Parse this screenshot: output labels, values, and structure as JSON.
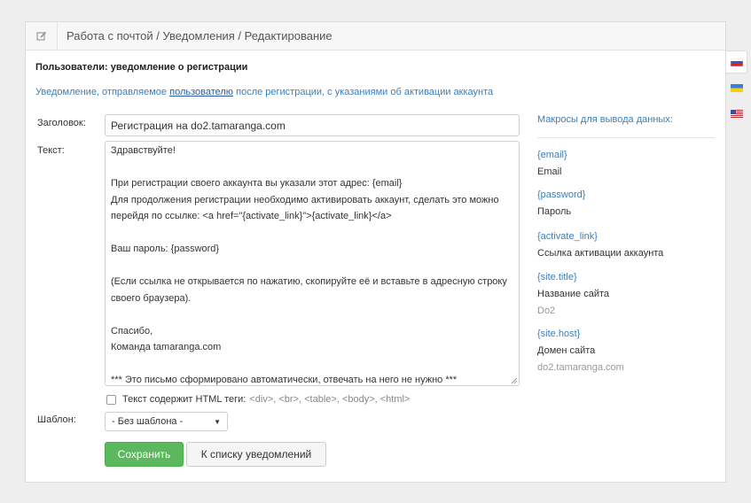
{
  "header": {
    "breadcrumb": "Работа с почтой / Уведомления / Редактирование",
    "icon": "edit-icon"
  },
  "section": {
    "title": "Пользователи: уведомление о регистрации",
    "description_before": "Уведомление, отправляемое ",
    "description_link": "пользователю",
    "description_after": " после регистрации, с указаниями об активации аккаунта"
  },
  "form": {
    "subject_label": "Заголовок:",
    "subject_value": "Регистрация на do2.tamaranga.com",
    "text_label": "Текст:",
    "text_lines": [
      "Здравствуйте!",
      "",
      "При регистрации своего аккаунта вы указали этот адрес: {email}",
      "Для продолжения регистрации необходимо активировать аккаунт, сделать это можно",
      "перейдя по ссылке: <a href=\"{activate_link}\">{activate_link}</a>",
      "",
      "Ваш пароль: {password}",
      "",
      "(Если ссылка не открывается по нажатию, скопируйте её и вставьте в адресную строку",
      "своего браузера).",
      "",
      "Спасибо,",
      "Команда tamaranga.com",
      "",
      "*** Это письмо сформировано автоматически, отвечать на него не нужно ***"
    ],
    "html_checkbox_label": "Текст содержит HTML теги:",
    "html_checkbox_tags": "<div>, <br>, <table>, <body>, <html>",
    "html_checkbox_checked": false,
    "template_label": "Шаблон:",
    "template_value": "- Без шаблона -",
    "save_button": "Сохранить",
    "back_button": "К списку уведомлений"
  },
  "macros": {
    "title": "Макросы для вывода данных:",
    "items": [
      {
        "code": "{email}",
        "desc": "Email",
        "value": ""
      },
      {
        "code": "{password}",
        "desc": "Пароль",
        "value": ""
      },
      {
        "code": "{activate_link}",
        "desc": "Ссылка активации аккаунта",
        "value": ""
      },
      {
        "code": "{site.title}",
        "desc": "Название сайта",
        "value": "Do2"
      },
      {
        "code": "{site.host}",
        "desc": "Домен сайта",
        "value": "do2.tamaranga.com"
      }
    ]
  },
  "languages": [
    {
      "name": "russian-flag-icon",
      "active": true
    },
    {
      "name": "ukrainian-flag-icon",
      "active": false
    },
    {
      "name": "english-flag-icon",
      "active": false
    }
  ],
  "colors": {
    "accent": "#3a7fbd",
    "save": "#5cb85c"
  }
}
